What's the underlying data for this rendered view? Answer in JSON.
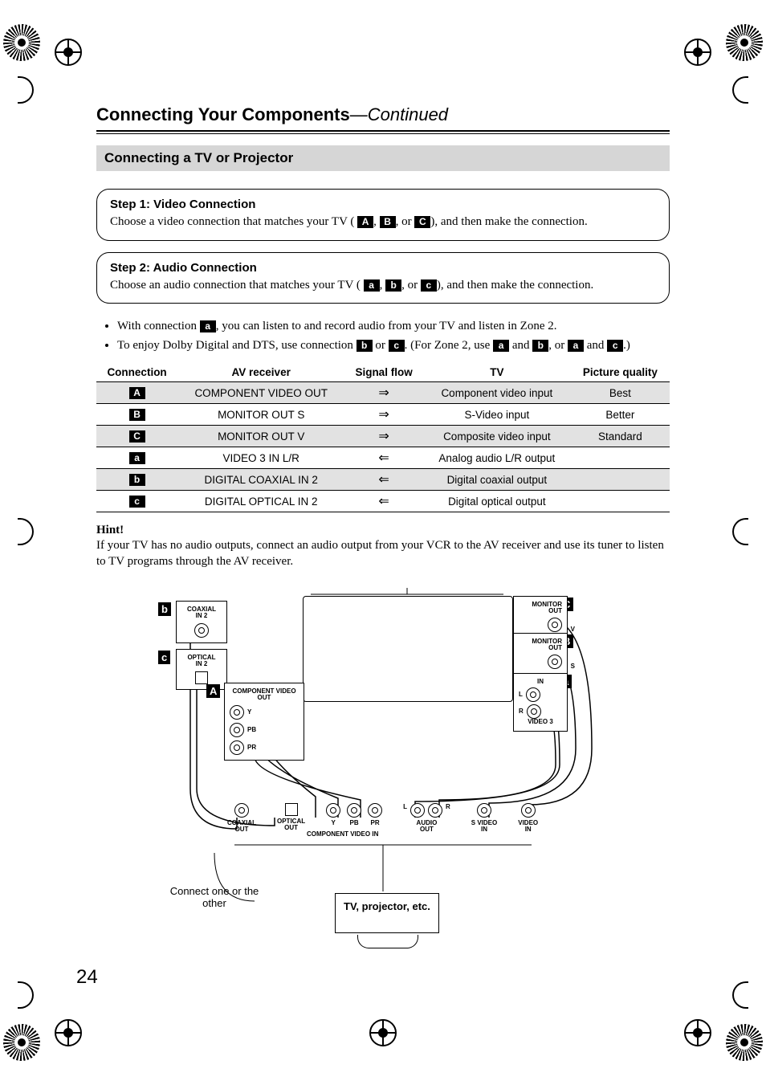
{
  "page_number": "24",
  "header": {
    "title": "Connecting Your Components",
    "continued": "—Continued"
  },
  "section_title": "Connecting a TV or Projector",
  "steps": [
    {
      "title": "Step 1: Video Connection",
      "body_prefix": "Choose a video connection that matches your TV (",
      "badges": [
        "A",
        "B",
        "C"
      ],
      "body_suffix": "), and then make the connection."
    },
    {
      "title": "Step 2: Audio Connection",
      "body_prefix": "Choose an audio connection that matches your TV (",
      "badges": [
        "a",
        "b",
        "c"
      ],
      "body_suffix": "), and then make the connection."
    }
  ],
  "bullets": {
    "b1_prefix": "With connection ",
    "b1_badge": "a",
    "b1_suffix": ", you can listen to and record audio from your TV and listen in Zone 2.",
    "b2_p1": "To enjoy Dolby Digital and DTS, use connection ",
    "b2_b1": "b",
    "b2_p2": " or ",
    "b2_b2": "c",
    "b2_p3": ". (For Zone 2, use ",
    "b2_b3": "a",
    "b2_p4": " and ",
    "b2_b4": "b",
    "b2_p5": ", or ",
    "b2_b5": "a",
    "b2_p6": " and ",
    "b2_b6": "c",
    "b2_p7": ".)"
  },
  "table": {
    "headers": [
      "Connection",
      "AV receiver",
      "Signal flow",
      "TV",
      "Picture quality"
    ],
    "rows": [
      {
        "badge": "A",
        "recv": "COMPONENT VIDEO OUT",
        "flow": "⇒",
        "tv": "Component video input",
        "pq": "Best",
        "shade": true
      },
      {
        "badge": "B",
        "recv": "MONITOR OUT S",
        "flow": "⇒",
        "tv": "S-Video input",
        "pq": "Better",
        "shade": false
      },
      {
        "badge": "C",
        "recv": "MONITOR OUT V",
        "flow": "⇒",
        "tv": "Composite video input",
        "pq": "Standard",
        "shade": true
      },
      {
        "badge": "a",
        "recv": "VIDEO 3 IN L/R",
        "flow": "⇐",
        "tv": "Analog audio L/R output",
        "pq": "",
        "shade": false
      },
      {
        "badge": "b",
        "recv": "DIGITAL COAXIAL IN 2",
        "flow": "⇐",
        "tv": "Digital coaxial output",
        "pq": "",
        "shade": true
      },
      {
        "badge": "c",
        "recv": "DIGITAL OPTICAL IN 2",
        "flow": "⇐",
        "tv": "Digital optical output",
        "pq": "",
        "shade": false
      }
    ]
  },
  "hint": {
    "title": "Hint!",
    "body": "If your TV has no audio outputs, connect an audio output from your VCR to the AV receiver and use its tuner to listen to TV programs through the AV receiver."
  },
  "diagram": {
    "badges": {
      "b": "b",
      "c": "c",
      "A": "A",
      "B": "B",
      "C": "C",
      "a": "a"
    },
    "labels": {
      "coaxial_in2": "COAXIAL\nIN 2",
      "optical_in2": "OPTICAL\nIN 2",
      "component_out": "COMPONENT VIDEO\nOUT",
      "comp_y": "Y",
      "comp_pb": "PB",
      "comp_pr": "PR",
      "monitor_out_v": "MONITOR\nOUT",
      "monitor_out_v_sub": "V",
      "monitor_out_s": "MONITOR\nOUT",
      "monitor_out_s_sub": "S",
      "in_lr": "IN",
      "l": "L",
      "r": "R",
      "video3": "VIDEO 3",
      "tv_box": "TV, projector, etc.",
      "connect_note": "Connect one or the other",
      "bottom": {
        "coax": "COAXIAL\nOUT",
        "opt": "OPTICAL\nOUT",
        "y": "Y",
        "pb": "PB",
        "pr": "PR",
        "comp": "COMPONENT VIDEO IN",
        "audio": "AUDIO\nOUT",
        "l": "L",
        "r": "R",
        "svideo": "S VIDEO\nIN",
        "video": "VIDEO\nIN"
      }
    }
  }
}
